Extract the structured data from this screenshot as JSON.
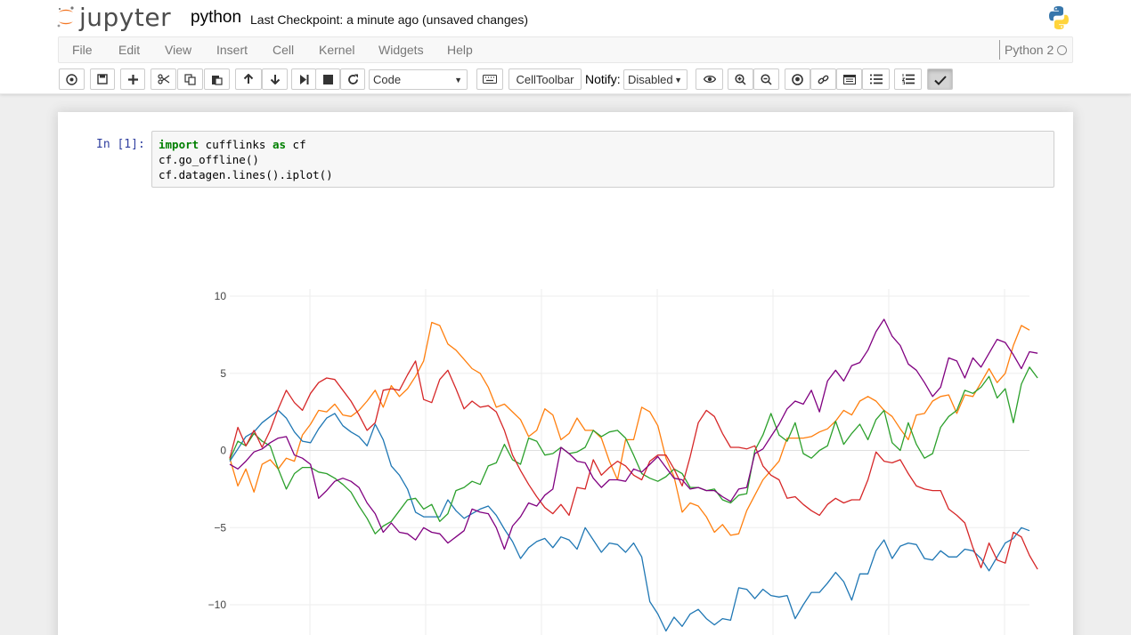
{
  "header": {
    "logo_text": "jupyter",
    "notebook_name": "python",
    "checkpoint": "Last Checkpoint: a minute ago (unsaved changes)"
  },
  "menu": [
    "File",
    "Edit",
    "View",
    "Insert",
    "Cell",
    "Kernel",
    "Widgets",
    "Help"
  ],
  "kernel": {
    "name": "Python 2"
  },
  "toolbar": {
    "cell_type": "Code",
    "celltoolbar_label": "CellToolbar",
    "notify_label": "Notify:",
    "notify_value": "Disabled"
  },
  "cell": {
    "prompt": "In [1]:",
    "code": [
      {
        "kw": "import",
        "rest": " cufflinks ",
        "kw2": "as",
        "rest2": " cf"
      },
      {
        "kw": "",
        "rest": "cf.go_offline()",
        "kw2": "",
        "rest2": ""
      },
      {
        "kw": "",
        "rest": "cf.datagen.lines().iplot()",
        "kw2": "",
        "rest2": ""
      }
    ]
  },
  "colors": {
    "series": [
      "#ff7f0e",
      "#1f77b4",
      "#2ca02c",
      "#d62728",
      "#800080"
    ],
    "code_keyword": "#008000",
    "prompt": "#303f9f"
  },
  "chart_data": {
    "type": "line",
    "title": "",
    "xlabel": "",
    "ylabel": "",
    "ylim": [
      -11.5,
      10.5
    ],
    "yticks": [
      "10",
      "5",
      "0",
      "−5",
      "−10"
    ],
    "ytick_values": [
      10,
      5,
      0,
      -5,
      -10
    ],
    "grid": true,
    "legend": "none",
    "x_count": 100,
    "series": [
      {
        "values": [
          -0.5,
          -2.3,
          -1.2,
          -2.7,
          -0.9,
          -0.6,
          -1.2,
          -0.5,
          -0.7,
          1.0,
          1.7,
          2.6,
          2.5,
          3.0,
          2.3,
          2.2,
          2.6,
          3.2,
          3.9,
          2.8,
          4.2,
          3.5,
          4.0,
          4.8,
          5.8,
          8.3,
          8.1,
          6.9,
          6.5,
          5.9,
          5.3,
          5.0,
          4.1,
          2.8,
          3.0,
          2.5,
          2.0,
          0.9,
          1.3,
          2.7,
          2.3,
          0.7,
          1.1,
          2.1,
          1.3,
          1.3,
          0.8,
          -0.7,
          -1.9,
          0.7,
          0.7,
          2.8,
          2.5,
          1.6,
          -0.5,
          -1.7,
          -4.0,
          -3.4,
          -3.6,
          -4.3,
          -5.3,
          -4.8,
          -5.5,
          -5.4,
          -3.9,
          -2.9,
          -1.9,
          -1.3,
          -0.7,
          0.8,
          0.8,
          0.8,
          0.9,
          1.2,
          1.4,
          1.9,
          2.6,
          2.3,
          3.2,
          3.5,
          3.2,
          2.6,
          2.2,
          1.4,
          0.7,
          2.3,
          2.4,
          3.2,
          3.5,
          3.6,
          2.4,
          3.6,
          3.5,
          4.4,
          5.3,
          4.4,
          5.0,
          6.8,
          8.1,
          7.8
        ]
      },
      {
        "values": [
          -0.7,
          0.1,
          0.9,
          1.2,
          1.8,
          2.2,
          2.6,
          2.1,
          1.2,
          0.6,
          0.5,
          1.4,
          2.1,
          2.4,
          1.6,
          1.2,
          0.9,
          0.3,
          1.7,
          0.7,
          -1.0,
          -1.6,
          -2.5,
          -4.0,
          -4.3,
          -4.3,
          -4.3,
          -3.2,
          -3.9,
          -4.4,
          -4.1,
          -3.8,
          -3.6,
          -4.2,
          -5.1,
          -5.9,
          -7.0,
          -6.3,
          -5.9,
          -5.7,
          -6.3,
          -5.6,
          -5.8,
          -6.4,
          -5.0,
          -5.8,
          -6.6,
          -6.0,
          -6.1,
          -6.6,
          -6.0,
          -6.9,
          -9.8,
          -10.6,
          -11.7,
          -10.8,
          -11.4,
          -10.6,
          -10.3,
          -10.9,
          -11.3,
          -10.9,
          -11.0,
          -8.9,
          -9.0,
          -9.6,
          -9.0,
          -9.4,
          -9.5,
          -9.4,
          -10.9,
          -10.0,
          -9.2,
          -9.2,
          -8.6,
          -7.9,
          -8.5,
          -9.7,
          -8.0,
          -8.0,
          -6.5,
          -5.8,
          -7.0,
          -6.2,
          -6.0,
          -6.1,
          -7.0,
          -7.1,
          -6.5,
          -6.9,
          -6.9,
          -6.4,
          -6.5,
          -7.0,
          -7.8,
          -6.9,
          -6.0,
          -5.7,
          -5.0,
          -5.2
        ]
      },
      {
        "values": [
          -0.6,
          0.6,
          0.3,
          1.1,
          0.6,
          0.3,
          -1.2,
          -2.5,
          -1.5,
          -1.1,
          -1.1,
          -1.4,
          -1.5,
          -1.8,
          -2.2,
          -2.7,
          -3.6,
          -4.4,
          -5.4,
          -4.9,
          -4.6,
          -3.9,
          -3.2,
          -3.1,
          -3.8,
          -3.5,
          -4.6,
          -4.1,
          -2.6,
          -2.4,
          -2.0,
          -2.2,
          -1.0,
          -0.8,
          0.4,
          -0.6,
          -0.9,
          0.8,
          0.6,
          -0.3,
          -0.2,
          0.2,
          -0.2,
          -0.1,
          0.2,
          1.3,
          0.9,
          1.2,
          1.3,
          0.8,
          -0.3,
          -1.5,
          -1.8,
          -2.0,
          -1.7,
          -1.2,
          -1.5,
          -2.4,
          -2.4,
          -2.6,
          -2.5,
          -3.2,
          -3.4,
          -2.9,
          -2.8,
          0.0,
          1.0,
          2.4,
          1.0,
          0.6,
          1.8,
          -0.2,
          -0.5,
          0.0,
          0.3,
          1.9,
          0.4,
          1.1,
          1.7,
          0.7,
          2.0,
          2.6,
          0.5,
          0.0,
          1.8,
          0.4,
          -0.5,
          -0.2,
          1.5,
          2.2,
          2.6,
          3.9,
          3.7,
          4.1,
          4.8,
          3.4,
          4.0,
          1.8,
          4.3,
          5.4,
          4.7
        ]
      },
      {
        "values": [
          -0.5,
          1.5,
          0.3,
          1.3,
          0.2,
          1.3,
          2.7,
          3.9,
          3.1,
          2.6,
          3.7,
          4.4,
          4.7,
          4.6,
          3.9,
          3.2,
          2.3,
          1.3,
          1.8,
          3.9,
          4.0,
          3.9,
          4.9,
          5.8,
          3.3,
          3.1,
          4.6,
          5.2,
          4.0,
          2.7,
          3.2,
          2.8,
          2.9,
          2.5,
          1.3,
          -0.3,
          -1.3,
          -2.2,
          -3.0,
          -3.7,
          -4.1,
          -3.5,
          -4.2,
          -2.4,
          -2.5,
          -0.6,
          -1.6,
          -1.1,
          -0.7,
          -1.0,
          -1.6,
          -1.9,
          -0.7,
          -0.3,
          -0.3,
          -1.2,
          -2.3,
          -0.4,
          1.8,
          2.6,
          2.2,
          1.1,
          0.2,
          0.2,
          0.1,
          0.3,
          -1.0,
          -1.6,
          -1.9,
          -3.1,
          -3.0,
          -3.5,
          -3.9,
          -4.2,
          -3.5,
          -3.1,
          -3.4,
          -3.2,
          -3.2,
          -1.9,
          -0.1,
          -0.7,
          -0.8,
          -0.6,
          -1.5,
          -2.3,
          -2.5,
          -2.6,
          -2.6,
          -3.8,
          -4.2,
          -4.7,
          -6.3,
          -7.6,
          -6.0,
          -7.1,
          -7.3,
          -5.3,
          -5.6,
          -6.8,
          -7.7
        ]
      },
      {
        "values": [
          -0.9,
          -1.2,
          -0.7,
          -0.1,
          0.1,
          0.5,
          0.8,
          0.9,
          -0.3,
          -0.5,
          -0.9,
          -3.1,
          -2.6,
          -2.0,
          -1.8,
          -2.0,
          -2.4,
          -3.4,
          -4.1,
          -5.3,
          -4.7,
          -5.3,
          -5.4,
          -5.8,
          -5.0,
          -5.3,
          -5.4,
          -6.0,
          -5.6,
          -5.2,
          -3.8,
          -4.0,
          -4.1,
          -5.0,
          -6.4,
          -4.9,
          -4.3,
          -3.4,
          -3.6,
          -2.9,
          -2.5,
          0.2,
          -0.2,
          -0.7,
          -0.8,
          -1.8,
          -2.4,
          -1.9,
          -1.9,
          -2.0,
          -1.2,
          -1.4,
          -0.9,
          -0.4,
          -1.1,
          -1.8,
          -1.9,
          -2.5,
          -2.4,
          -2.6,
          -2.6,
          -3.0,
          -3.3,
          -2.5,
          -2.4,
          -0.2,
          0.1,
          0.9,
          1.7,
          2.7,
          3.2,
          3.0,
          3.9,
          2.5,
          4.5,
          5.2,
          4.5,
          5.5,
          5.7,
          6.5,
          7.7,
          8.5,
          7.4,
          6.8,
          5.6,
          5.2,
          4.4,
          3.5,
          4.1,
          6.0,
          5.8,
          4.7,
          6.0,
          5.4,
          6.3,
          7.2,
          7.0,
          6.2,
          5.3,
          6.4,
          6.3
        ]
      }
    ]
  }
}
